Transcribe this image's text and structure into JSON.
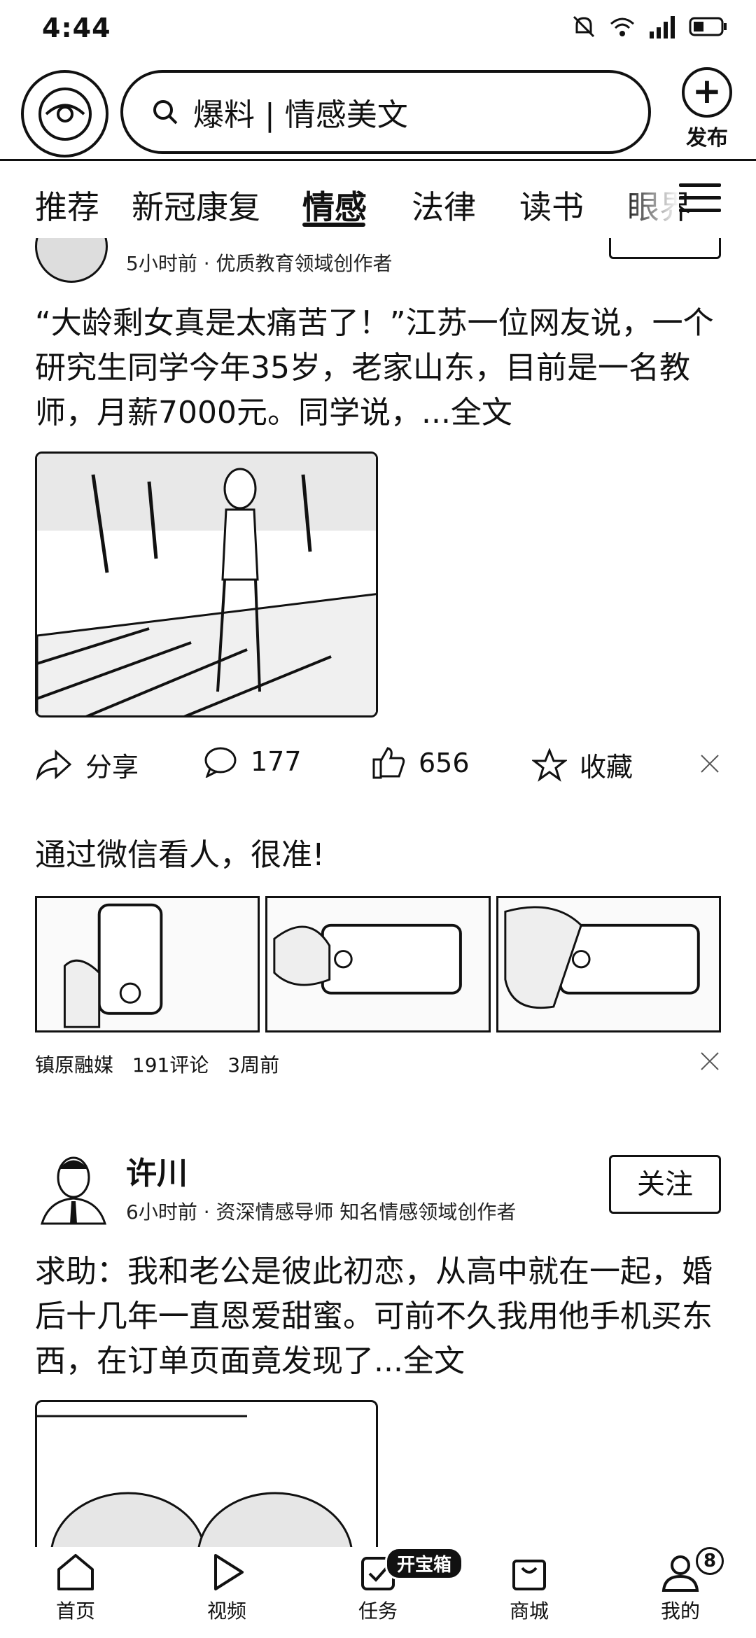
{
  "status_bar": {
    "time": "4:44"
  },
  "header": {
    "search_text": "爆料 | 情感美文",
    "publish_label": "发布"
  },
  "tabs": [
    {
      "label": "推荐"
    },
    {
      "label": "新冠康复"
    },
    {
      "label": "情感"
    },
    {
      "label": "法律"
    },
    {
      "label": "读书"
    },
    {
      "label": "眼界"
    }
  ],
  "feed": {
    "post1": {
      "meta": "5小时前 · 优质教育领域创作者",
      "text": "“大龄剩女真是太痛苦了！”江苏一位网友说，一个研究生同学今年35岁，老家山东，目前是一名教师，月薪7000元。同学说，...全文",
      "share_label": "分享",
      "comments": "177",
      "likes": "656",
      "favorite_label": "收藏"
    },
    "post2": {
      "title": "通过微信看人，很准!",
      "source": "镇原融媒",
      "comments": "191评论",
      "time": "3周前"
    },
    "post3": {
      "author": "许川",
      "meta": "6小时前 · 资深情感导师 知名情感领域创作者",
      "follow_label": "关注",
      "text": "求助：我和老公是彼此初恋，从高中就在一起，婚后十几年一直恩爱甜蜜。可前不久我用他手机买东西，在订单页面竟发现了...全文"
    }
  },
  "bottom_nav": [
    {
      "label": "首页",
      "icon": "home-icon"
    },
    {
      "label": "视频",
      "icon": "play-icon"
    },
    {
      "label": "任务",
      "icon": "task-icon"
    },
    {
      "label": "商城",
      "icon": "bag-icon"
    },
    {
      "label": "我的",
      "icon": "user-icon"
    }
  ],
  "task_badge": "开宝箱",
  "me_badge": "8"
}
